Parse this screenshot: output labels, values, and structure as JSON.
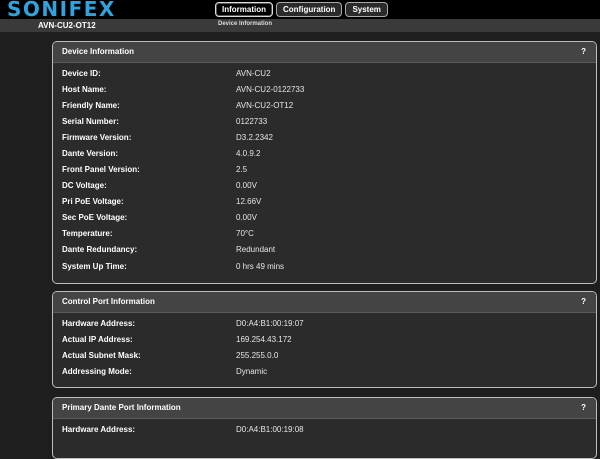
{
  "header": {
    "logo": "SONIFEX",
    "tabs": [
      {
        "label": "Information",
        "active": true
      },
      {
        "label": "Configuration",
        "active": false
      },
      {
        "label": "System",
        "active": false
      }
    ],
    "device_name": "AVN-CU2-OT12",
    "breadcrumb": "Device Information",
    "logo_color": "#2ea3de"
  },
  "panels": {
    "device": {
      "title": "Device Information",
      "help": "?",
      "rows": [
        {
          "label": "Device ID:",
          "value": "AVN-CU2"
        },
        {
          "label": "Host Name:",
          "value": "AVN-CU2-0122733"
        },
        {
          "label": "Friendly Name:",
          "value": "AVN-CU2-OT12"
        },
        {
          "label": "Serial Number:",
          "value": "0122733"
        },
        {
          "label": "Firmware Version:",
          "value": "D3.2.2342"
        },
        {
          "label": "Dante Version:",
          "value": "4.0.9.2"
        },
        {
          "label": "Front Panel Version:",
          "value": "2.5"
        },
        {
          "label": "DC Voltage:",
          "value": "0.00V"
        },
        {
          "label": "Pri PoE Voltage:",
          "value": "12.66V"
        },
        {
          "label": "Sec PoE Voltage:",
          "value": "0.00V"
        },
        {
          "label": "Temperature:",
          "value": "70°C"
        },
        {
          "label": "Dante Redundancy:",
          "value": "Redundant"
        },
        {
          "label": "System Up Time:",
          "value": "0 hrs 49 mins"
        }
      ]
    },
    "control": {
      "title": "Control Port Information",
      "help": "?",
      "rows": [
        {
          "label": "Hardware Address:",
          "value": "D0:A4:B1:00:19:07"
        },
        {
          "label": "Actual IP Address:",
          "value": "169.254.43.172"
        },
        {
          "label": "Actual Subnet Mask:",
          "value": "255.255.0.0"
        },
        {
          "label": "Addressing Mode:",
          "value": "Dynamic"
        }
      ]
    },
    "primary": {
      "title": "Primary Dante Port Information",
      "help": "?",
      "rows": [
        {
          "label": "Hardware Address:",
          "value": "D0:A4:B1:00:19:08"
        }
      ]
    }
  }
}
